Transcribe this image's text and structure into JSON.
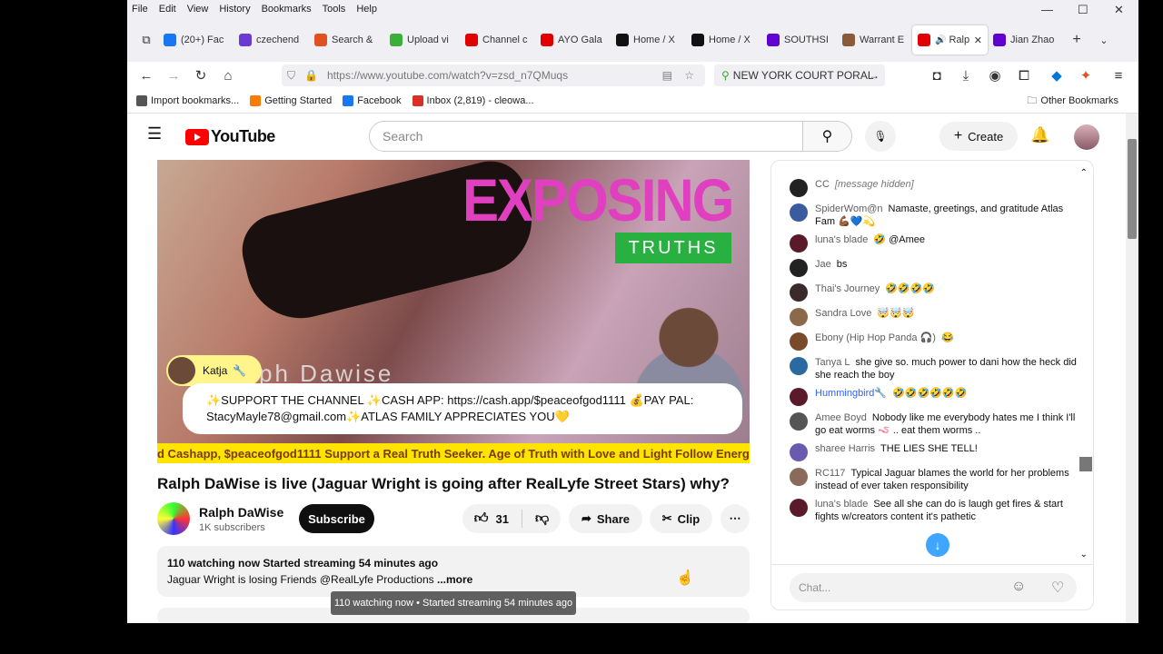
{
  "menubar": {
    "items": [
      "File",
      "Edit",
      "View",
      "History",
      "Bookmarks",
      "Tools",
      "Help"
    ]
  },
  "tabs": [
    {
      "label": "(20+) Fac",
      "color": "#1877f2"
    },
    {
      "label": "czechend",
      "color": "#6a3bd3"
    },
    {
      "label": "Search &",
      "color": "#e05020"
    },
    {
      "label": "Upload vi",
      "color": "#3ab03a"
    },
    {
      "label": "Channel c",
      "color": "#e00000"
    },
    {
      "label": "AYO Gala",
      "color": "#e00000"
    },
    {
      "label": "Home / X",
      "color": "#111111"
    },
    {
      "label": "Home / X",
      "color": "#111111"
    },
    {
      "label": "SOUTHSI",
      "color": "#6001d2"
    },
    {
      "label": "Warrant E",
      "color": "#8a5a3a"
    },
    {
      "label": "Ralp",
      "color": "#e00000",
      "active": true
    },
    {
      "label": "Jian Zhao",
      "color": "#6001d2"
    }
  ],
  "nav": {
    "url": "https://www.youtube.com/watch?v=zsd_n7QMuqs",
    "extension_box": "NEW YORK COURT PORAL"
  },
  "bookmarks": {
    "items": [
      {
        "label": "Import bookmarks...",
        "color": "#555555"
      },
      {
        "label": "Getting Started",
        "color": "#ff7b00"
      },
      {
        "label": "Facebook",
        "color": "#1877f2"
      },
      {
        "label": "Inbox (2,819) - cleowa...",
        "color": "#d93025"
      }
    ],
    "other": "Other Bookmarks"
  },
  "youtube": {
    "logo": "YouTube",
    "search_placeholder": "Search",
    "create_label": "Create"
  },
  "video": {
    "overlay_title": "EXPOSING",
    "overlay_sub": "TRUTHS",
    "guest_name": "Katja",
    "host_overlay": "ph Dawise",
    "promo_line1": "✨SUPPORT THE CHANNEL ✨CASH APP: https://cash.app/$peaceofgod1111 💰PAY PAL:",
    "promo_line2": "StacyMayle78@gmail.com✨ATLAS FAMILY APPRECIATES YOU💛",
    "ticker": "d Cashapp, $peaceofgod1111 Support a Real Truth Seeker. Age of Truth with Love and Light Follow Energyof"
  },
  "title": "Ralph DaWise is live (Jaguar Wright is going after RealLyfe Street Stars) why?",
  "channel": {
    "name": "Ralph DaWise",
    "subscribers": "1K subscribers",
    "subscribe_label": "Subscribe"
  },
  "actions": {
    "likes": "31",
    "share": "Share",
    "clip": "Clip",
    "more": "⋯"
  },
  "description": {
    "line1": "110 watching now  Started streaming 54 minutes ago",
    "line2": "Jaguar Wright is losing Friends @RealLyfe Productions ",
    "more": "...more"
  },
  "tooltip": "110 watching now • Started streaming 54 minutes ago",
  "chat": {
    "messages": [
      {
        "author": "CC",
        "text": "[message hidden]",
        "color": "#222222"
      },
      {
        "author": "SpiderWom@n",
        "text": "Namaste, greetings, and gratitude Atlas Fam 💪🏾💙💫",
        "color": "#3a5ba0"
      },
      {
        "author": "luna's blade",
        "text": "🤣 @Amee",
        "color": "#5a1a2a"
      },
      {
        "author": "Jae",
        "text": "bs",
        "color": "#222222"
      },
      {
        "author": "Thai's Journey",
        "text": "🤣🤣🤣🤣",
        "color": "#3a2a2a"
      },
      {
        "author": "Sandra Love",
        "text": "🤯🤯🤯",
        "color": "#8a6a4a"
      },
      {
        "author": "Ebony (Hip Hop Panda 🎧)",
        "text": "😂",
        "color": "#7a4a2a"
      },
      {
        "author": "Tanya L",
        "text": "she give so. much power to dani how the heck did she reach the boy",
        "color": "#2a6aa0"
      },
      {
        "author": "Hummingbird🔧",
        "text": "🤣🤣🤣🤣🤣🤣",
        "color": "#5a1a2a"
      },
      {
        "author": "Amee Boyd",
        "text": "Nobody like me everybody hates me I think I'll go eat worms 🪱 .. eat them worms ..",
        "color": "#555555"
      },
      {
        "author": "sharee Harris",
        "text": "THE LIES SHE TELL!",
        "color": "#6a5ab0"
      },
      {
        "author": "RC117",
        "text": "Typical Jaguar blames the world for her problems instead of ever taken responsibility",
        "color": "#8a6a5a"
      },
      {
        "author": "luna's blade",
        "text": "See all she can do is laugh get fires & start fights w/creators content it's pathetic",
        "color": "#5a1a2a"
      }
    ],
    "input_placeholder": "Chat..."
  }
}
